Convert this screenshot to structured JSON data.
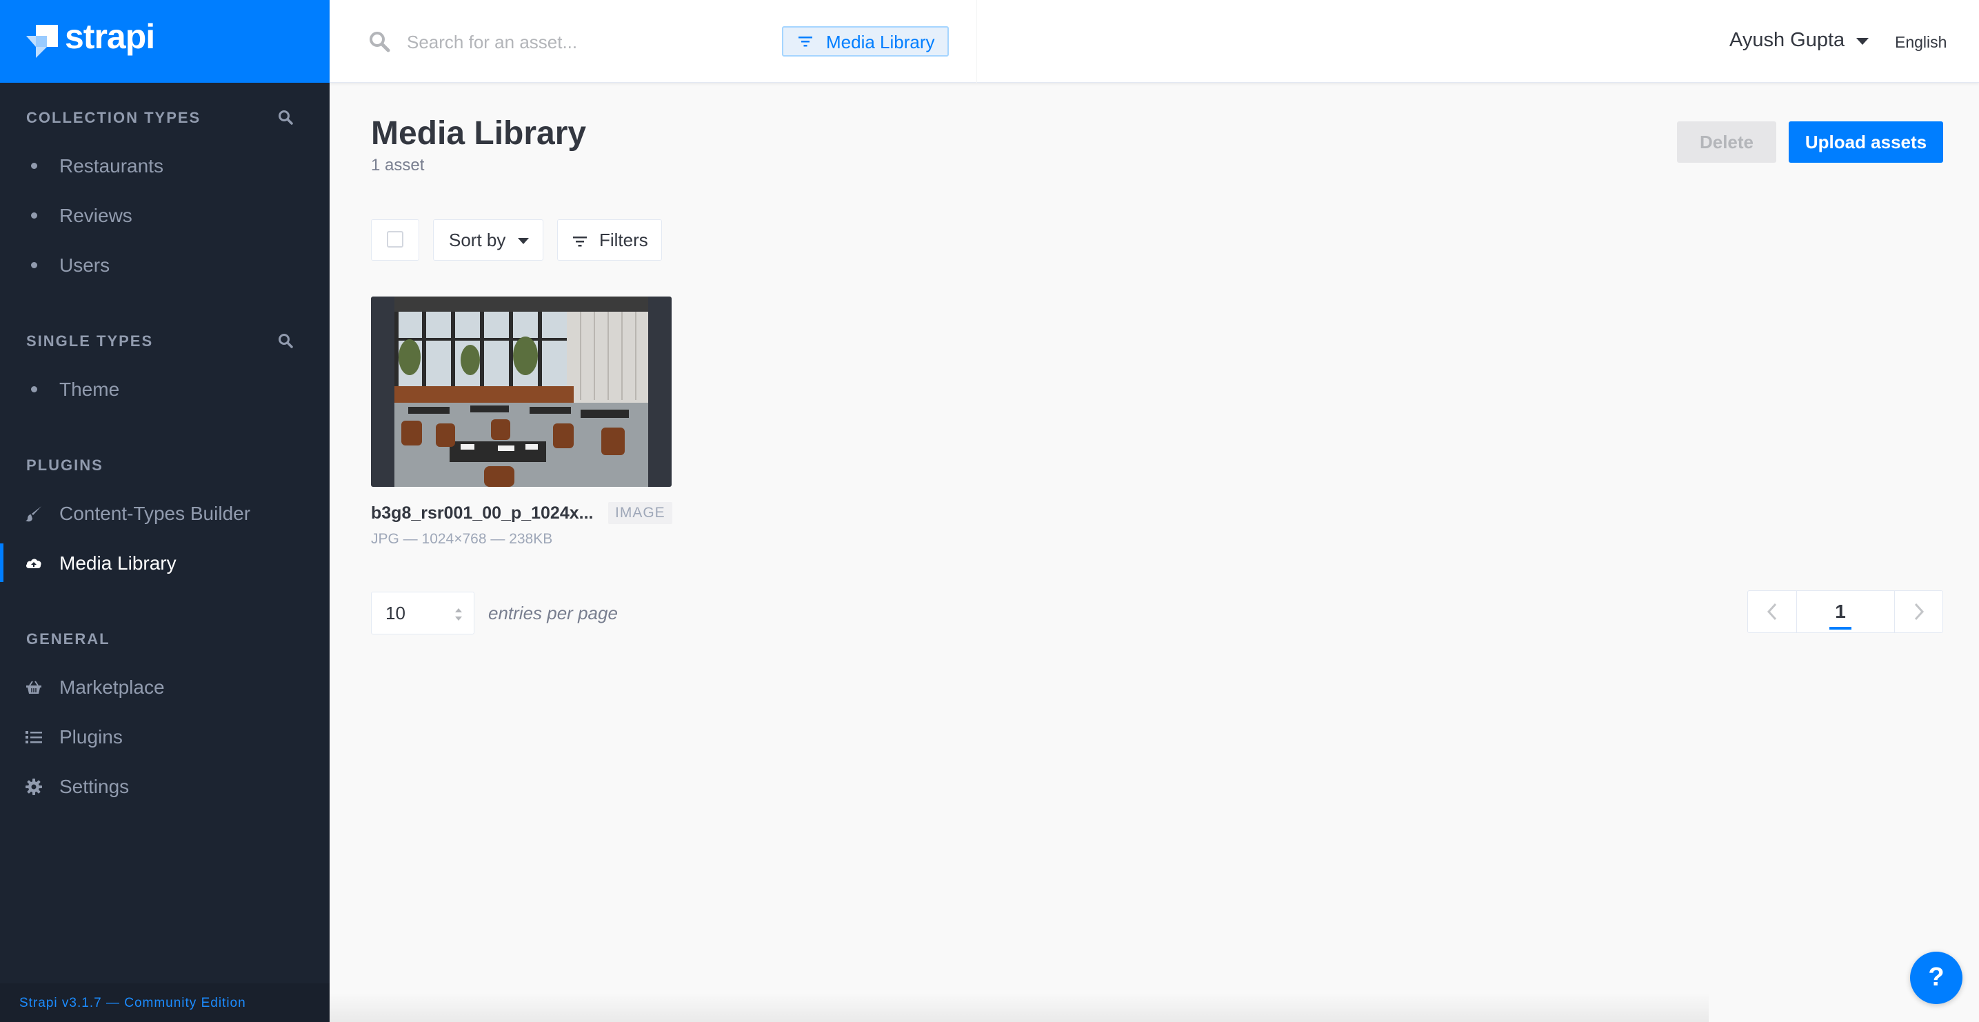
{
  "brand": {
    "name": "strapi",
    "color": "#007eff"
  },
  "sidebar": {
    "sections": [
      {
        "title": "COLLECTION TYPES",
        "items": [
          {
            "label": "Restaurants"
          },
          {
            "label": "Reviews"
          },
          {
            "label": "Users"
          }
        ]
      },
      {
        "title": "SINGLE TYPES",
        "items": [
          {
            "label": "Theme"
          }
        ]
      },
      {
        "title": "PLUGINS",
        "items": [
          {
            "label": "Content-Types Builder",
            "icon": "paintbrush-icon"
          },
          {
            "label": "Media Library",
            "icon": "cloud-upload-icon",
            "active": true
          }
        ]
      },
      {
        "title": "GENERAL",
        "items": [
          {
            "label": "Marketplace",
            "icon": "basket-icon"
          },
          {
            "label": "Plugins",
            "icon": "list-icon"
          },
          {
            "label": "Settings",
            "icon": "gear-icon"
          }
        ]
      }
    ],
    "footer": "Strapi v3.1.7 — Community Edition"
  },
  "topbar": {
    "search_placeholder": "Search for an asset...",
    "filter_tag": "Media Library",
    "user_name": "Ayush Gupta",
    "language": "English"
  },
  "main": {
    "title": "Media Library",
    "subtitle": "1 asset",
    "delete_label": "Delete",
    "upload_label": "Upload assets",
    "sort_label": "Sort by",
    "filters_label": "Filters",
    "assets": [
      {
        "name": "b3g8_rsr001_00_p_1024x...",
        "type": "IMAGE",
        "meta": "JPG — 1024×768 — 238KB"
      }
    ],
    "per_page_value": "10",
    "per_page_label": "entries per page",
    "current_page": "1"
  },
  "help_label": "?"
}
